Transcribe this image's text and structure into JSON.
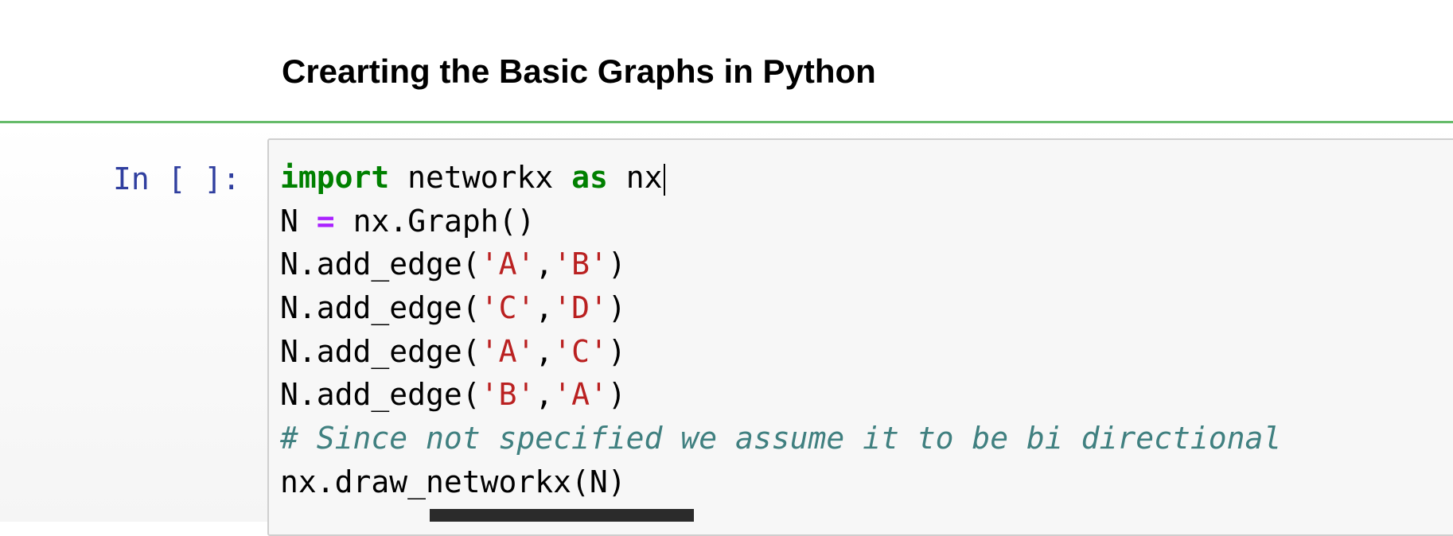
{
  "markdown": {
    "heading": "Crearting the Basic Graphs in Python"
  },
  "code_cell": {
    "prompt": "In [ ]:",
    "lines": [
      {
        "module": "networkx",
        "alias": "nx"
      },
      {
        "var": "N",
        "call": "nx.Graph()"
      },
      {
        "call": "N.add_edge",
        "args": [
          "A",
          "B"
        ]
      },
      {
        "call": "N.add_edge",
        "args": [
          "C",
          "D"
        ]
      },
      {
        "call": "N.add_edge",
        "args": [
          "A",
          "C"
        ]
      },
      {
        "call": "N.add_edge",
        "args": [
          "B",
          "A"
        ]
      },
      {
        "comment": "# Since not specified we assume it to be bi directional"
      },
      {
        "code": "nx.draw_networkx(N)"
      }
    ]
  },
  "syntax_colors": {
    "keyword": "#008000",
    "operator": "#aa22ff",
    "string": "#ba2121",
    "comment": "#408080",
    "prompt": "#303f9f"
  }
}
